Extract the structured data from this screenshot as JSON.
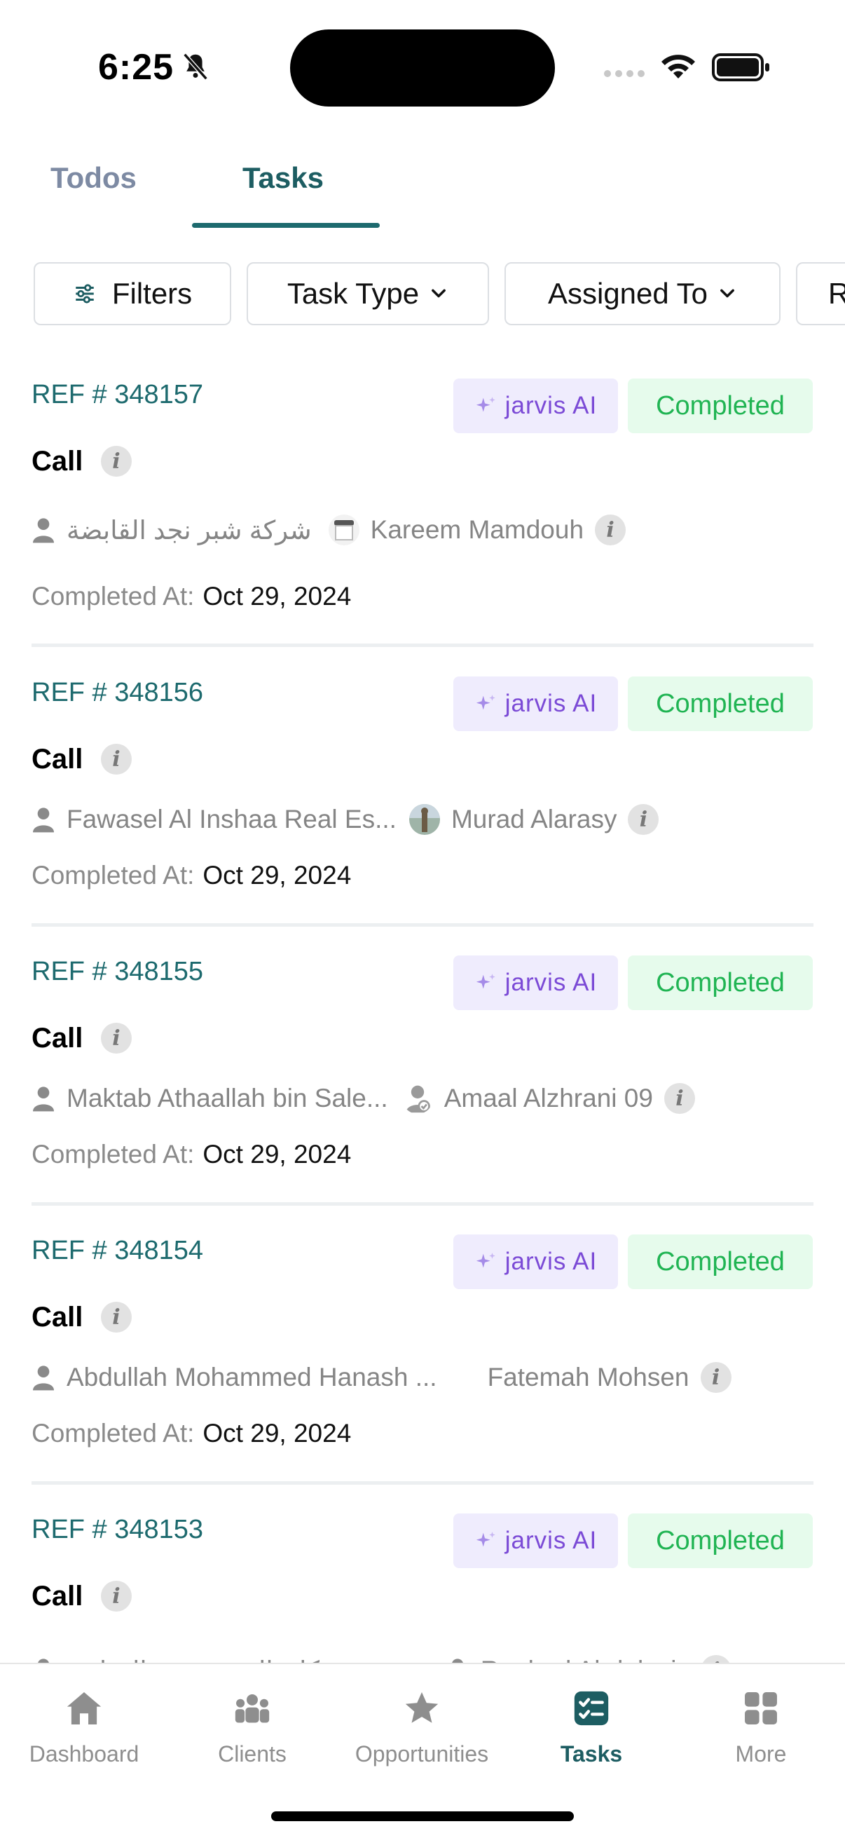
{
  "status_bar": {
    "time": "6:25"
  },
  "tabs": [
    {
      "label": "Todos"
    },
    {
      "label": "Tasks"
    }
  ],
  "filters": [
    {
      "label": "Filters"
    },
    {
      "label": "Task Type"
    },
    {
      "label": "Assigned To"
    },
    {
      "label": "R"
    }
  ],
  "tasks": [
    {
      "ref": "REF # 348157",
      "ai_label": "jarvis AI",
      "status": "Completed",
      "title": "Call",
      "client": "شركة شبر نجد القابضة",
      "assignee": "Kareem Mamdouh",
      "completed_label": "Completed At:",
      "completed_date": "Oct 29, 2024"
    },
    {
      "ref": "REF # 348156",
      "ai_label": "jarvis AI",
      "status": "Completed",
      "title": "Call",
      "client": "Fawasel Al Inshaa Real Es...",
      "assignee": "Murad Alarasy",
      "completed_label": "Completed At:",
      "completed_date": "Oct 29, 2024"
    },
    {
      "ref": "REF # 348155",
      "ai_label": "jarvis AI",
      "status": "Completed",
      "title": "Call",
      "client": "Maktab Athaallah bin Sale...",
      "assignee": "Amaal Alzhrani 09",
      "completed_label": "Completed At:",
      "completed_date": "Oct 29, 2024"
    },
    {
      "ref": "REF # 348154",
      "ai_label": "jarvis AI",
      "status": "Completed",
      "title": "Call",
      "client": "Abdullah Mohammed Hanash ...",
      "assignee": "Fatemah Mohsen",
      "completed_label": "Completed At:",
      "completed_date": "Oct 29, 2024"
    },
    {
      "ref": "REF # 348153",
      "ai_label": "jarvis AI",
      "status": "Completed",
      "title": "Call",
      "client": "مؤسسة مكان المستشفى التجاري",
      "assignee": "Raghad Abdulaziz"
    }
  ],
  "bottom_nav": [
    {
      "label": "Dashboard",
      "icon": "home-icon"
    },
    {
      "label": "Clients",
      "icon": "people-icon"
    },
    {
      "label": "Opportunities",
      "icon": "star-icon"
    },
    {
      "label": "Tasks",
      "icon": "checklist-icon"
    },
    {
      "label": "More",
      "icon": "grid-icon"
    }
  ],
  "colors": {
    "primary": "#1d6a6e",
    "completed_text": "#20b453",
    "completed_bg": "#e6fbec",
    "ai_text": "#7b4ad6",
    "ai_bg": "#efecfd"
  }
}
